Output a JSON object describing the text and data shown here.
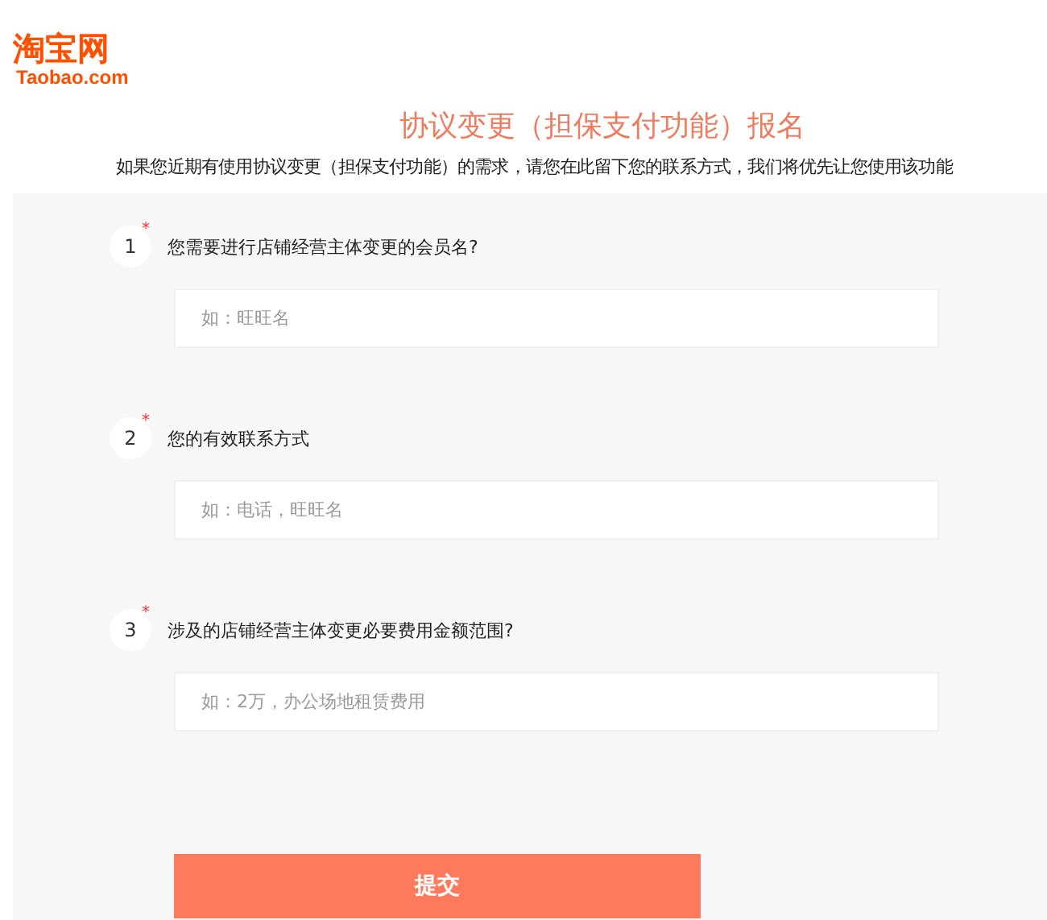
{
  "logo": {
    "name": "淘宝网",
    "domain": "Taobao.com"
  },
  "title": "协议变更（担保支付功能）报名",
  "subtitle": "如果您近期有使用协议变更（担保支付功能）的需求，请您在此留下您的联系方式，我们将优先让您使用该功能",
  "questions": [
    {
      "number": "1",
      "required_mark": "*",
      "label": "您需要进行店铺经营主体变更的会员名?",
      "placeholder": "如：旺旺名"
    },
    {
      "number": "2",
      "required_mark": "*",
      "label": "您的有效联系方式",
      "placeholder": "如：电话，旺旺名"
    },
    {
      "number": "3",
      "required_mark": "*",
      "label": "涉及的店铺经营主体变更必要费用金额范围?",
      "placeholder": "如：2万，办公场地租赁费用"
    }
  ],
  "submit": "提交"
}
